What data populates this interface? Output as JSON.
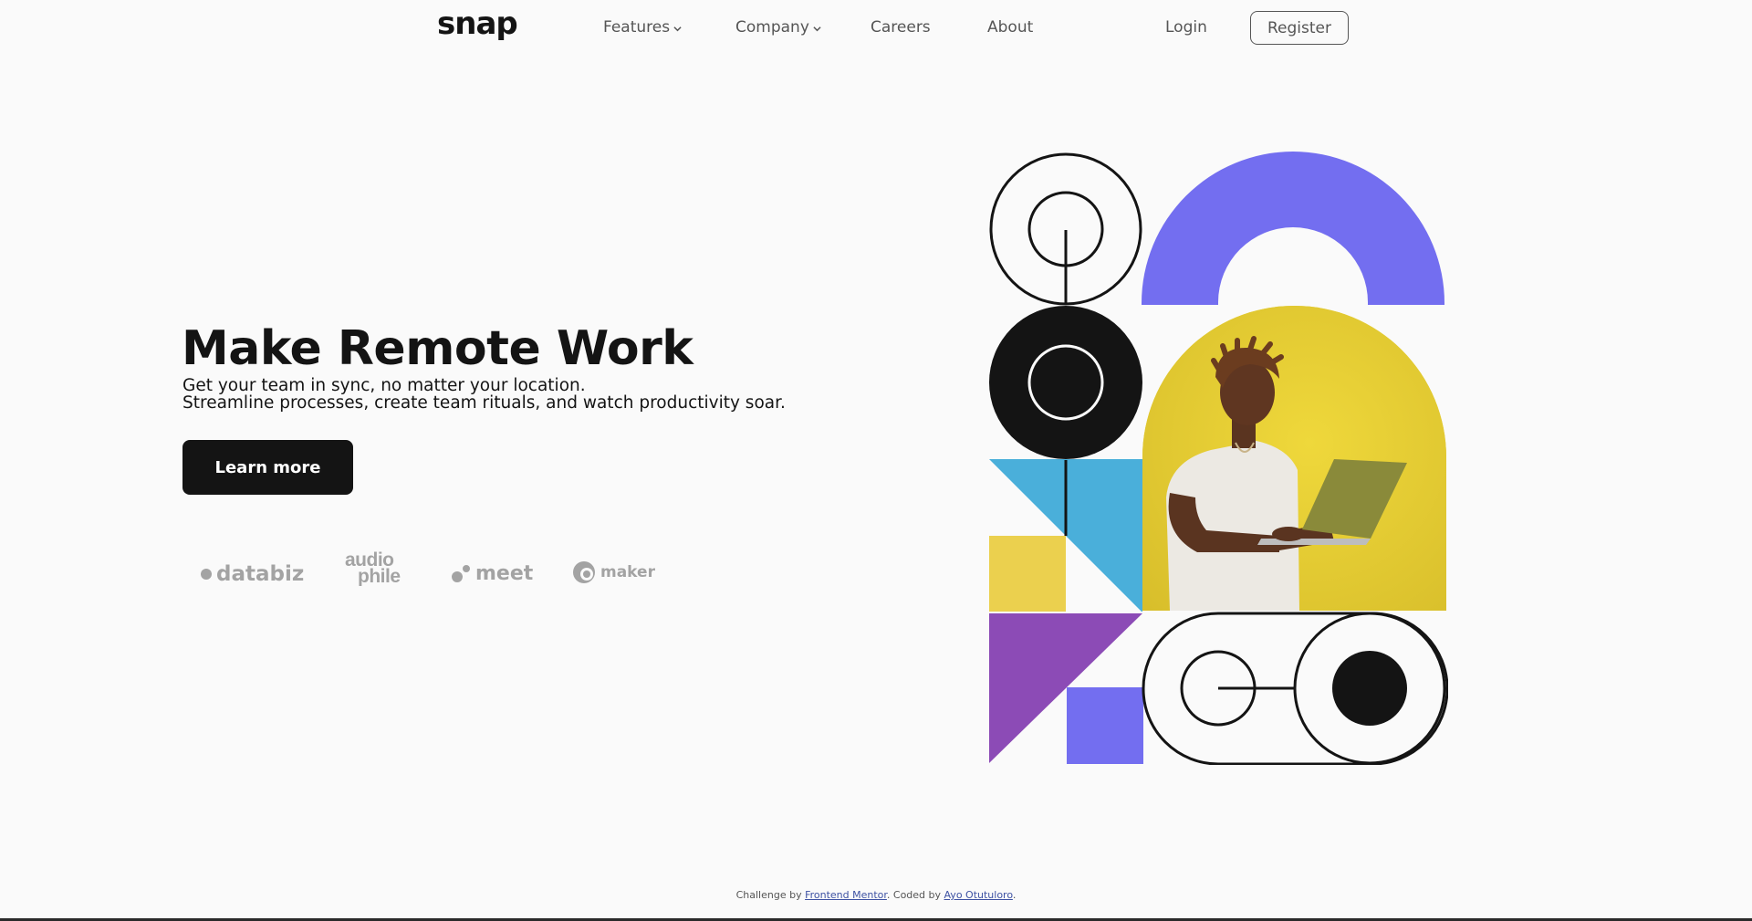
{
  "nav": {
    "logo": "snap",
    "items": [
      {
        "label": "Features",
        "has_dropdown": true
      },
      {
        "label": "Company",
        "has_dropdown": true
      },
      {
        "label": "Careers",
        "has_dropdown": false
      },
      {
        "label": "About",
        "has_dropdown": false
      }
    ],
    "login": "Login",
    "register": "Register"
  },
  "hero": {
    "title": "Make Remote Work",
    "line1": "Get your team in sync, no matter your location.",
    "line2": "Streamline processes, create team rituals, and watch productivity soar.",
    "cta": "Learn more"
  },
  "clients": [
    "databiz",
    "audiophile",
    "meet",
    "maker"
  ],
  "colors": {
    "dark": "#141414",
    "purple": "#736ef0",
    "yellow": "#ebd04e",
    "blue": "#4aafda",
    "violet": "#8c4bb6",
    "gray_text": "#a3a3a3"
  },
  "footer": {
    "prefix": "Challenge by",
    "link1": "Frontend Mentor",
    "mid": ". Coded by",
    "link2": "Ayo Otutuloro",
    "suffix": "."
  }
}
